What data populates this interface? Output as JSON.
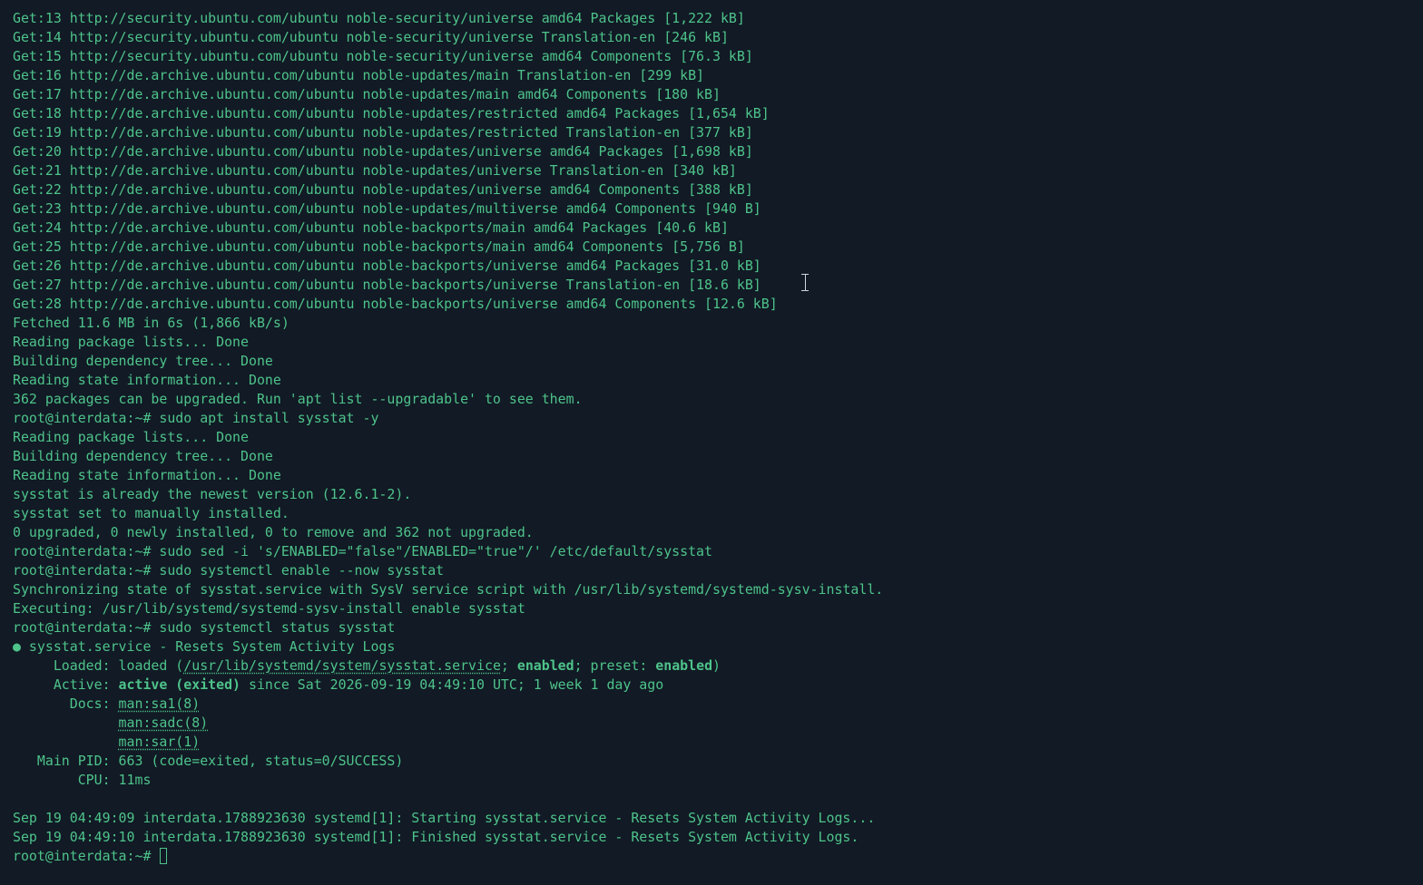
{
  "terminal": {
    "prompt": "root@interdata:~# ",
    "colors": {
      "background": "#111a25",
      "text": "#4ec38a"
    },
    "lines": [
      "Get:13 http://security.ubuntu.com/ubuntu noble-security/universe amd64 Packages [1,222 kB]",
      "Get:14 http://security.ubuntu.com/ubuntu noble-security/universe Translation-en [246 kB]",
      "Get:15 http://security.ubuntu.com/ubuntu noble-security/universe amd64 Components [76.3 kB]",
      "Get:16 http://de.archive.ubuntu.com/ubuntu noble-updates/main Translation-en [299 kB]",
      "Get:17 http://de.archive.ubuntu.com/ubuntu noble-updates/main amd64 Components [180 kB]",
      "Get:18 http://de.archive.ubuntu.com/ubuntu noble-updates/restricted amd64 Packages [1,654 kB]",
      "Get:19 http://de.archive.ubuntu.com/ubuntu noble-updates/restricted Translation-en [377 kB]",
      "Get:20 http://de.archive.ubuntu.com/ubuntu noble-updates/universe amd64 Packages [1,698 kB]",
      "Get:21 http://de.archive.ubuntu.com/ubuntu noble-updates/universe Translation-en [340 kB]",
      "Get:22 http://de.archive.ubuntu.com/ubuntu noble-updates/universe amd64 Components [388 kB]",
      "Get:23 http://de.archive.ubuntu.com/ubuntu noble-updates/multiverse amd64 Components [940 B]",
      "Get:24 http://de.archive.ubuntu.com/ubuntu noble-backports/main amd64 Packages [40.6 kB]",
      "Get:25 http://de.archive.ubuntu.com/ubuntu noble-backports/main amd64 Components [5,756 B]",
      "Get:26 http://de.archive.ubuntu.com/ubuntu noble-backports/universe amd64 Packages [31.0 kB]",
      "Get:27 http://de.archive.ubuntu.com/ubuntu noble-backports/universe Translation-en [18.6 kB]",
      "Get:28 http://de.archive.ubuntu.com/ubuntu noble-backports/universe amd64 Components [12.6 kB]",
      "Fetched 11.6 MB in 6s (1,866 kB/s)",
      "Reading package lists... Done",
      "Building dependency tree... Done",
      "Reading state information... Done",
      "362 packages can be upgraded. Run 'apt list --upgradable' to see them.",
      "root@interdata:~# sudo apt install sysstat -y",
      "Reading package lists... Done",
      "Building dependency tree... Done",
      "Reading state information... Done",
      "sysstat is already the newest version (12.6.1-2).",
      "sysstat set to manually installed.",
      "0 upgraded, 0 newly installed, 0 to remove and 362 not upgraded.",
      "root@interdata:~# sudo sed -i 's/ENABLED=\"false\"/ENABLED=\"true\"/' /etc/default/sysstat",
      "root@interdata:~# sudo systemctl enable --now sysstat",
      "Synchronizing state of sysstat.service with SysV service script with /usr/lib/systemd/systemd-sysv-install.",
      "Executing: /usr/lib/systemd/systemd-sysv-install enable sysstat",
      "root@interdata:~# sudo systemctl status sysstat"
    ],
    "status": {
      "bullet": "●",
      "service_line": " sysstat.service - Resets System Activity Logs",
      "loaded_label": "     Loaded: ",
      "loaded_pre": "loaded (",
      "loaded_path": "/usr/lib/systemd/system/sysstat.service",
      "loaded_mid1": "; ",
      "loaded_enabled": "enabled",
      "loaded_mid2": "; preset: ",
      "loaded_preset": "enabled",
      "loaded_post": ")",
      "active_label": "     Active: ",
      "active_state": "active (exited)",
      "active_rest": " since Sat 2026-09-19 04:49:10 UTC; 1 week 1 day ago",
      "docs_label": "       Docs: ",
      "docs_indent": "             ",
      "docs": [
        "man:sa1(8)",
        "man:sadc(8)",
        "man:sar(1)"
      ],
      "main_pid": "   Main PID: 663 (code=exited, status=0/SUCCESS)",
      "cpu": "        CPU: 11ms"
    },
    "log_lines": [
      "Sep 19 04:49:09 interdata.1788923630 systemd[1]: Starting sysstat.service - Resets System Activity Logs...",
      "Sep 19 04:49:10 interdata.1788923630 systemd[1]: Finished sysstat.service - Resets System Activity Logs."
    ]
  }
}
